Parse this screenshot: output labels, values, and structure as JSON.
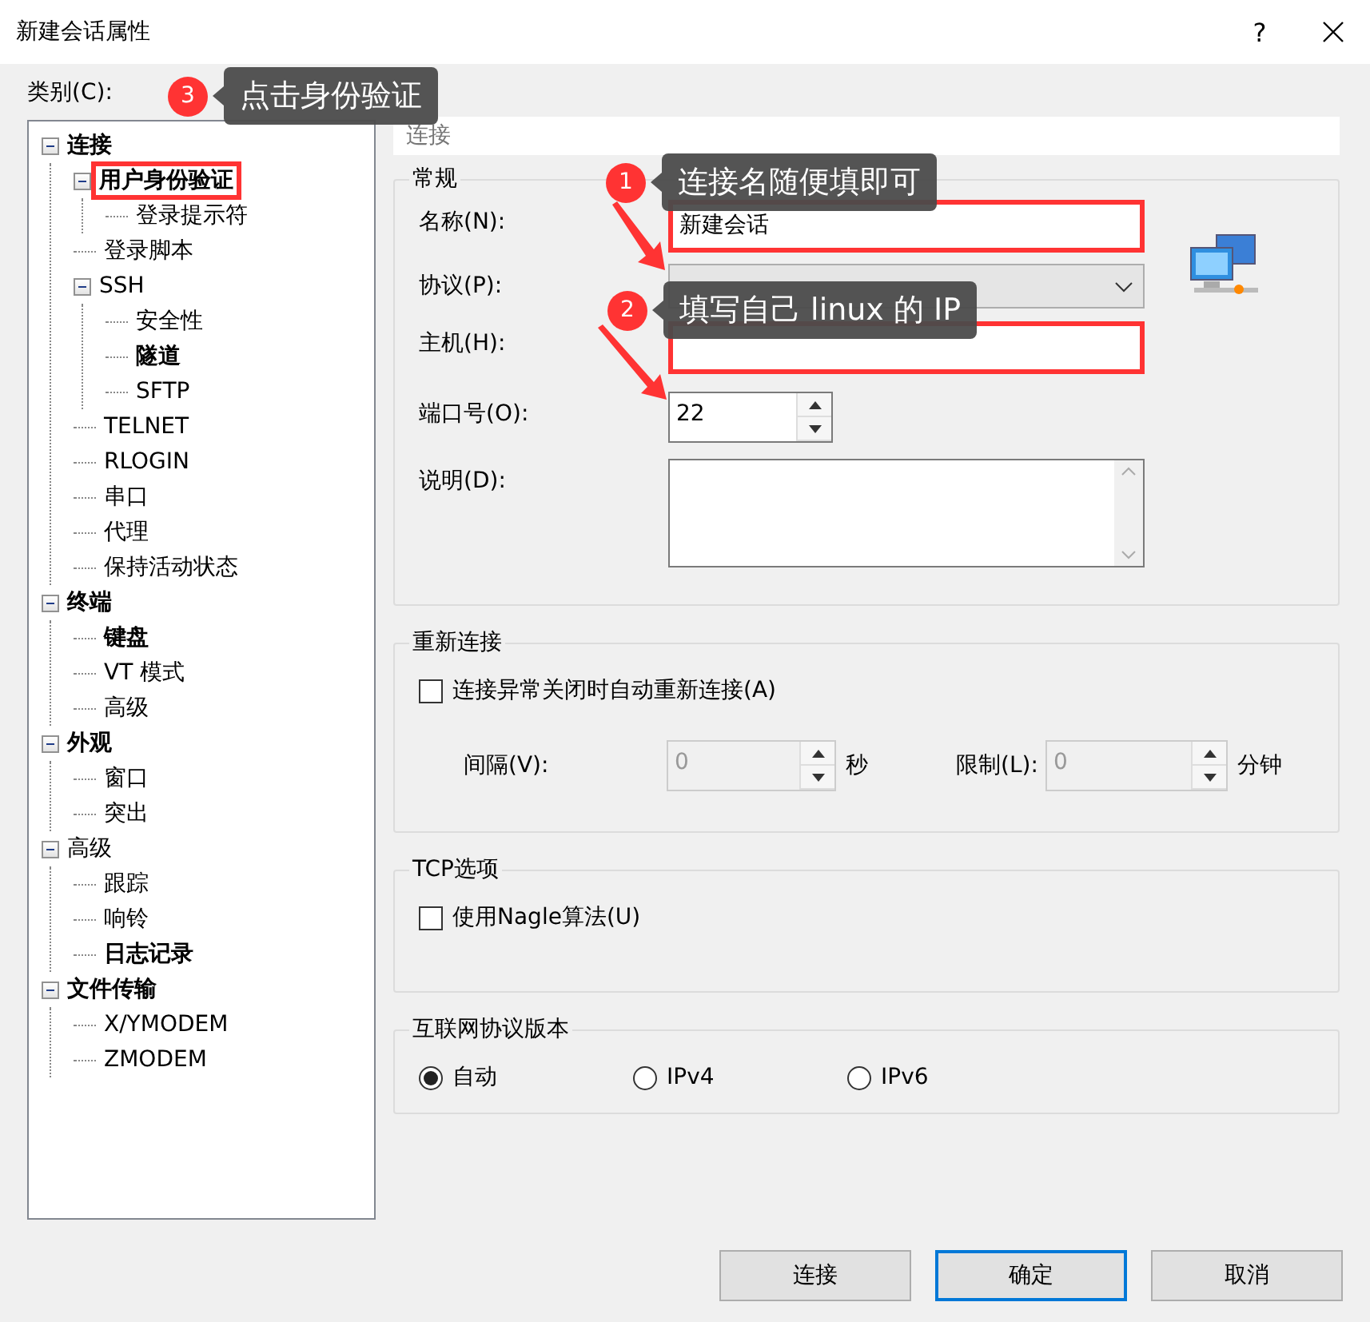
{
  "window": {
    "title": "新建会话属性",
    "help": "?"
  },
  "category_label": "类别(C):",
  "tree": [
    {
      "label": "连接",
      "bold": true,
      "expanded": true,
      "marked": false,
      "children": [
        {
          "label": "用户身份验证",
          "bold": true,
          "expanded": true,
          "marked": true,
          "children": [
            {
              "label": "登录提示符",
              "bold": false,
              "marked": false
            }
          ]
        },
        {
          "label": "登录脚本",
          "bold": false,
          "marked": false
        },
        {
          "label": "SSH",
          "bold": false,
          "expanded": true,
          "marked": false,
          "children": [
            {
              "label": "安全性",
              "bold": false,
              "marked": false
            },
            {
              "label": "隧道",
              "bold": true,
              "marked": false
            },
            {
              "label": "SFTP",
              "bold": false,
              "marked": false
            }
          ]
        },
        {
          "label": "TELNET",
          "bold": false,
          "marked": false
        },
        {
          "label": "RLOGIN",
          "bold": false,
          "marked": false
        },
        {
          "label": "串口",
          "bold": false,
          "marked": false
        },
        {
          "label": "代理",
          "bold": false,
          "marked": false
        },
        {
          "label": "保持活动状态",
          "bold": false,
          "marked": false
        }
      ]
    },
    {
      "label": "终端",
      "bold": true,
      "expanded": true,
      "marked": false,
      "children": [
        {
          "label": "键盘",
          "bold": true,
          "marked": false
        },
        {
          "label": "VT 模式",
          "bold": false,
          "marked": false
        },
        {
          "label": "高级",
          "bold": false,
          "marked": false
        }
      ]
    },
    {
      "label": "外观",
      "bold": true,
      "expanded": true,
      "marked": false,
      "children": [
        {
          "label": "窗口",
          "bold": false,
          "marked": false
        },
        {
          "label": "突出",
          "bold": false,
          "marked": false
        }
      ]
    },
    {
      "label": "高级",
      "bold": false,
      "expanded": true,
      "marked": false,
      "children": [
        {
          "label": "跟踪",
          "bold": false,
          "marked": false
        },
        {
          "label": "响铃",
          "bold": false,
          "marked": false
        },
        {
          "label": "日志记录",
          "bold": true,
          "marked": false
        }
      ]
    },
    {
      "label": "文件传输",
      "bold": true,
      "expanded": true,
      "marked": false,
      "children": [
        {
          "label": "X/YMODEM",
          "bold": false,
          "marked": false
        },
        {
          "label": "ZMODEM",
          "bold": false,
          "marked": false
        }
      ]
    }
  ],
  "panel_header": "连接",
  "general": {
    "title": "常规",
    "fields": [
      {
        "kind": "text",
        "label": "名称(N):",
        "value": "新建会话",
        "marked": true
      },
      {
        "kind": "combo",
        "label": "协议(P):",
        "marked": false
      },
      {
        "kind": "text",
        "label": "主机(H):",
        "marked": true
      },
      {
        "kind": "spin",
        "label": "端口号(O):",
        "value": "22",
        "marked": false
      },
      {
        "kind": "memo",
        "label": "说明(D):",
        "marked": false
      }
    ]
  },
  "reconnect": {
    "title": "重新连接",
    "checkbox": {
      "label": "连接异常关闭时自动重新连接(A)",
      "checked": false
    },
    "spins": [
      {
        "label": "间隔(V):",
        "value": "0",
        "unit": "秒",
        "disabled": true
      },
      {
        "label": "限制(L):",
        "value": "0",
        "unit": "分钟",
        "disabled": true
      }
    ]
  },
  "tcp": {
    "title": "TCP选项",
    "checkbox": {
      "label": "使用Nagle算法(U)",
      "checked": false
    }
  },
  "ip_version": {
    "title": "互联网协议版本",
    "options": [
      {
        "label": "自动",
        "selected": true
      },
      {
        "label": "IPv4",
        "selected": false
      },
      {
        "label": "IPv6",
        "selected": false
      }
    ]
  },
  "buttons": [
    {
      "label": "连接",
      "default": false
    },
    {
      "label": "确定",
      "default": true
    },
    {
      "label": "取消",
      "default": false
    }
  ],
  "annotations": [
    {
      "number": "3",
      "text": "点击身份验证",
      "arrow": false
    },
    {
      "number": "1",
      "text": "连接名随便填即可",
      "arrow": true
    },
    {
      "number": "2",
      "text": "填写自己 linux 的 IP",
      "arrow": true
    }
  ]
}
